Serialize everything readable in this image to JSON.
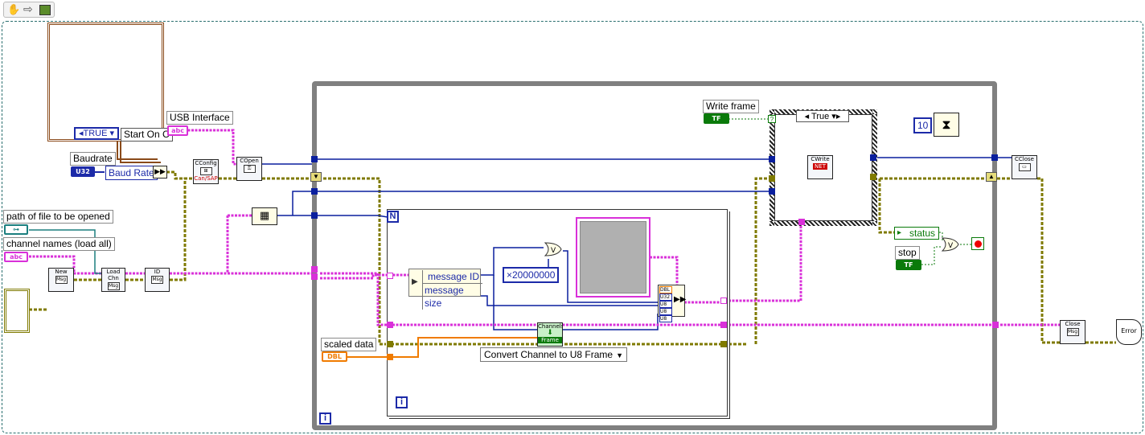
{
  "toolbar": {
    "icons": [
      "hand-icon",
      "arrow-icon",
      "run-icon"
    ]
  },
  "labels": {
    "usb_interface": "USB Interface",
    "baudrate": "Baudrate",
    "baud_rate_node": "Baud Rate",
    "path_of_file": "path of file to be opened",
    "channel_names": "channel names (load all)",
    "write_frame": "Write frame",
    "status": "status",
    "stop": "stop",
    "scaled_data": "scaled data",
    "start_on": "Start On C",
    "true_case": "TRUE",
    "true_selector": "True",
    "message_id": "message ID",
    "message_size": "message size",
    "const_20000000": "×20000000",
    "const_10": "10",
    "convert_mode": "Convert Channel to U8 Frame",
    "loop_count_N": "N",
    "iter_inner": "i",
    "iter_outer": "i"
  },
  "types": {
    "str": "abc",
    "path": "⊶",
    "u32": "U32",
    "dbl": "DBL",
    "bool": "TF"
  },
  "vis": {
    "config": {
      "top": "CConfig",
      "bottom": "Can/SAP"
    },
    "open": {
      "top": "COpen"
    },
    "new_msg": {
      "top": "New",
      "bottom": "Msg"
    },
    "load_chn": {
      "top": "Load Chn",
      "bottom": "Msg"
    },
    "id_msg": {
      "top": "ID",
      "bottom": "Msg"
    },
    "write": {
      "top": "CWrite",
      "bottom": "NET"
    },
    "close": {
      "top": "CClose"
    },
    "close_msg": {
      "top": "Close",
      "bottom": "Msg"
    },
    "error": {
      "top": "Error"
    },
    "channels_frame": {
      "top": "Channels",
      "bottom": "Frame"
    },
    "build_ports": [
      "DBL",
      "U32",
      "U8",
      "U8",
      "U8"
    ]
  },
  "colors": {
    "error_cluster": "#7f7a00",
    "refnum": "#0a1f9e",
    "string": "#d930d9",
    "dbl": "#f07b00",
    "boolean": "#0a7a0a",
    "while_loop": "#808080",
    "dashed_border": "#2a6f6f"
  }
}
